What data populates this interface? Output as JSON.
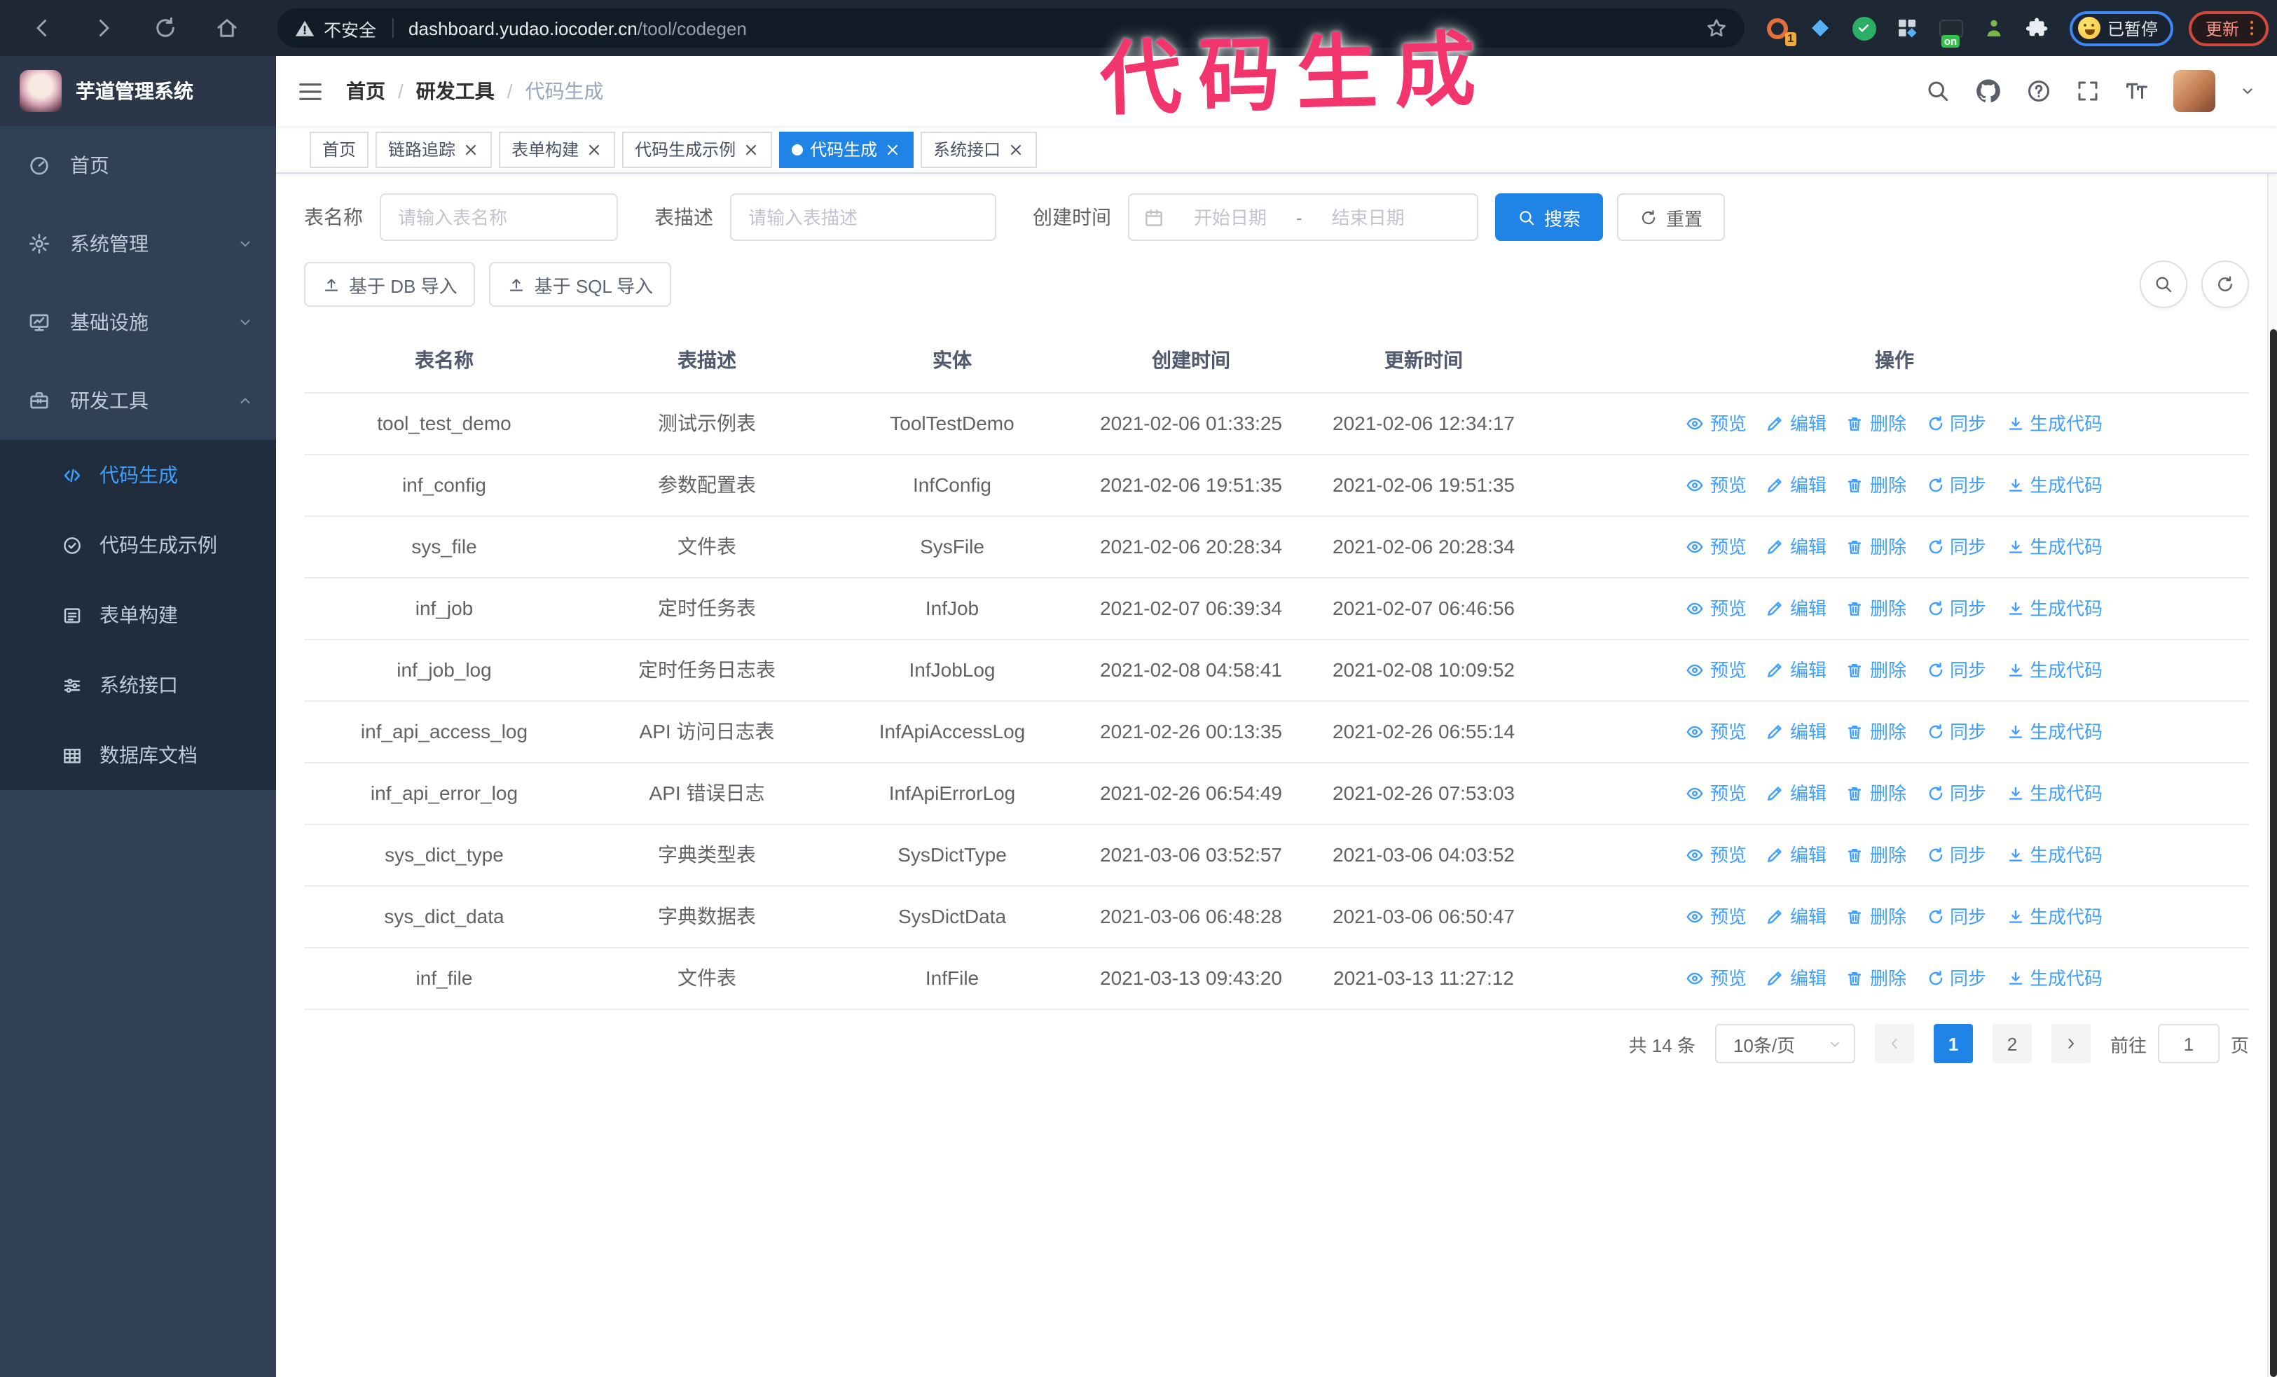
{
  "browser": {
    "security_label": "不安全",
    "url_host": "dashboard.yudao.iocoder.cn",
    "url_path": "/tool/codegen",
    "extension_badge": "1",
    "extension_on_badge": "on",
    "paused_chip": "已暂停",
    "update_button": "更新"
  },
  "annotation": {
    "text": "代码生成",
    "color": "#f2356d"
  },
  "sidebar": {
    "logo_title": "芋道管理系统",
    "items": [
      {
        "label": "首页"
      },
      {
        "label": "系统管理"
      },
      {
        "label": "基础设施"
      },
      {
        "label": "研发工具"
      }
    ],
    "submenu": [
      {
        "label": "代码生成"
      },
      {
        "label": "代码生成示例"
      },
      {
        "label": "表单构建"
      },
      {
        "label": "系统接口"
      },
      {
        "label": "数据库文档"
      }
    ]
  },
  "header": {
    "breadcrumb": [
      "首页",
      "研发工具",
      "代码生成"
    ]
  },
  "tabs": [
    {
      "label": "首页"
    },
    {
      "label": "链路追踪"
    },
    {
      "label": "表单构建"
    },
    {
      "label": "代码生成示例"
    },
    {
      "label": "代码生成"
    },
    {
      "label": "系统接口"
    }
  ],
  "filters": {
    "name_label": "表名称",
    "name_placeholder": "请输入表名称",
    "desc_label": "表描述",
    "desc_placeholder": "请输入表描述",
    "time_label": "创建时间",
    "start_placeholder": "开始日期",
    "range_separator": "-",
    "end_placeholder": "结束日期",
    "search_label": "搜索",
    "reset_label": "重置"
  },
  "toolbar": {
    "import_db_label": "基于 DB 导入",
    "import_sql_label": "基于 SQL 导入"
  },
  "table": {
    "headers": [
      "表名称",
      "表描述",
      "实体",
      "创建时间",
      "更新时间",
      "操作"
    ],
    "actions": [
      "预览",
      "编辑",
      "删除",
      "同步",
      "生成代码"
    ],
    "rows": [
      {
        "name": "tool_test_demo",
        "desc": "测试示例表",
        "entity": "ToolTestDemo",
        "created": "2021-02-06 01:33:25",
        "updated": "2021-02-06 12:34:17"
      },
      {
        "name": "inf_config",
        "desc": "参数配置表",
        "entity": "InfConfig",
        "created": "2021-02-06 19:51:35",
        "updated": "2021-02-06 19:51:35"
      },
      {
        "name": "sys_file",
        "desc": "文件表",
        "entity": "SysFile",
        "created": "2021-02-06 20:28:34",
        "updated": "2021-02-06 20:28:34"
      },
      {
        "name": "inf_job",
        "desc": "定时任务表",
        "entity": "InfJob",
        "created": "2021-02-07 06:39:34",
        "updated": "2021-02-07 06:46:56"
      },
      {
        "name": "inf_job_log",
        "desc": "定时任务日志表",
        "entity": "InfJobLog",
        "created": "2021-02-08 04:58:41",
        "updated": "2021-02-08 10:09:52"
      },
      {
        "name": "inf_api_access_log",
        "desc": "API 访问日志表",
        "entity": "InfApiAccessLog",
        "created": "2021-02-26 00:13:35",
        "updated": "2021-02-26 06:55:14"
      },
      {
        "name": "inf_api_error_log",
        "desc": "API 错误日志",
        "entity": "InfApiErrorLog",
        "created": "2021-02-26 06:54:49",
        "updated": "2021-02-26 07:53:03"
      },
      {
        "name": "sys_dict_type",
        "desc": "字典类型表",
        "entity": "SysDictType",
        "created": "2021-03-06 03:52:57",
        "updated": "2021-03-06 04:03:52"
      },
      {
        "name": "sys_dict_data",
        "desc": "字典数据表",
        "entity": "SysDictData",
        "created": "2021-03-06 06:48:28",
        "updated": "2021-03-06 06:50:47"
      },
      {
        "name": "inf_file",
        "desc": "文件表",
        "entity": "InfFile",
        "created": "2021-03-13 09:43:20",
        "updated": "2021-03-13 11:27:12"
      }
    ]
  },
  "pagination": {
    "total": "共 14 条",
    "page_size": "10条/页",
    "pages": [
      "1",
      "2"
    ],
    "goto_label": "前往",
    "goto_value": "1",
    "goto_suffix": "页"
  },
  "colors": {
    "accent": "#409eff",
    "primary_button": "#2083e6",
    "annotation": "#f2356d",
    "sidebar_bg": "#304156",
    "submenu_bg": "#1f2d3d"
  }
}
